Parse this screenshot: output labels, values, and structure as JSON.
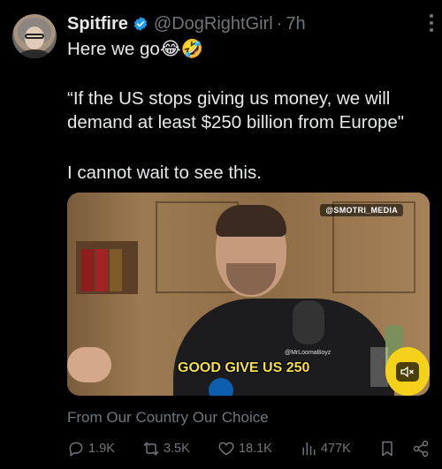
{
  "tweet": {
    "display_name": "Spitfire",
    "handle": "@DogRightGirl",
    "separator": "·",
    "time": "7h",
    "text_line1": "Here we go😂🤣",
    "quote": "“If the US stops giving us money, we will demand at least $250 billion from Europe\"",
    "text_line3": "I cannot wait to see this."
  },
  "media": {
    "watermark": "@SMOTRI_MEDIA",
    "mid_watermark": "@MrLoomaBoyz",
    "caption": "GOOD GIVE US 250"
  },
  "card": {
    "source": "From Our Country Our Choice"
  },
  "actions": {
    "replies": "1.9K",
    "reposts": "3.5K",
    "likes": "18.1K",
    "views": "477K"
  },
  "colors": {
    "background": "#000000",
    "text": "#e7e9ea",
    "muted": "#71767b",
    "verified": "#1d9bf0",
    "caption": "#f5e04a"
  }
}
